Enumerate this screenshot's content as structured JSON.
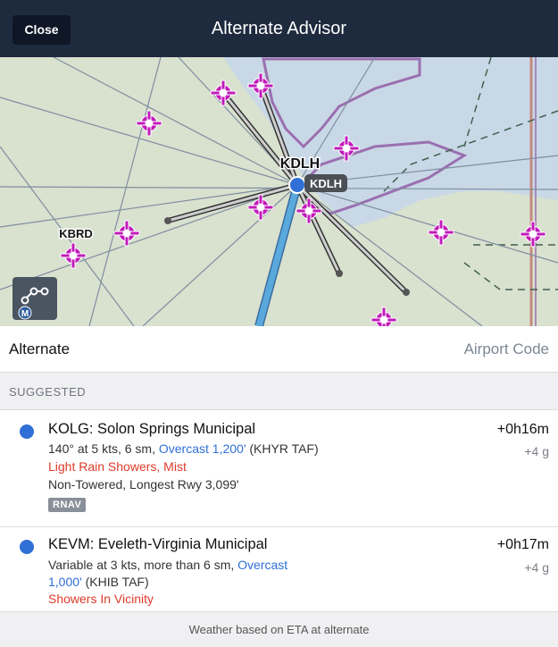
{
  "header": {
    "close_label": "Close",
    "title": "Alternate Advisor"
  },
  "map": {
    "labels": {
      "kdlh_top": "KDLH",
      "kdlh_badge": "KDLH",
      "kbrd": "KBRD",
      "m_badge": "M"
    },
    "colors": {
      "land": "#d9e1cf",
      "water": "#c9d8e6",
      "airport": "#c21aba",
      "route": "#5aa9dd"
    },
    "icons": [
      "airport-icon",
      "route-tool-icon"
    ]
  },
  "alternate": {
    "label": "Alternate",
    "placeholder": "Airport Code"
  },
  "section": {
    "title": "SUGGESTED"
  },
  "results": [
    {
      "name": "KOLG: Solon Springs Municipal",
      "time": "+0h16m",
      "fuel": "+4 g",
      "wind_prefix": "140° at 5 kts, 6 sm, ",
      "ceiling": "Overcast 1,200'",
      "source": " (KHYR TAF)",
      "weather": "Light Rain Showers, Mist",
      "info": "Non-Towered, Longest Rwy 3,099'",
      "badge": "RNAV"
    },
    {
      "name": "KEVM: Eveleth-Virginia Municipal",
      "time": "+0h17m",
      "fuel": "+4 g",
      "wind_prefix": "Variable at 3 kts, more than 6 sm, ",
      "ceiling_a": "Overcast",
      "ceiling_b": "1,000'",
      "source": " (KHIB TAF)",
      "weather": "Showers In Vicinity"
    }
  ],
  "footer": {
    "note": "Weather based on ETA at alternate"
  }
}
